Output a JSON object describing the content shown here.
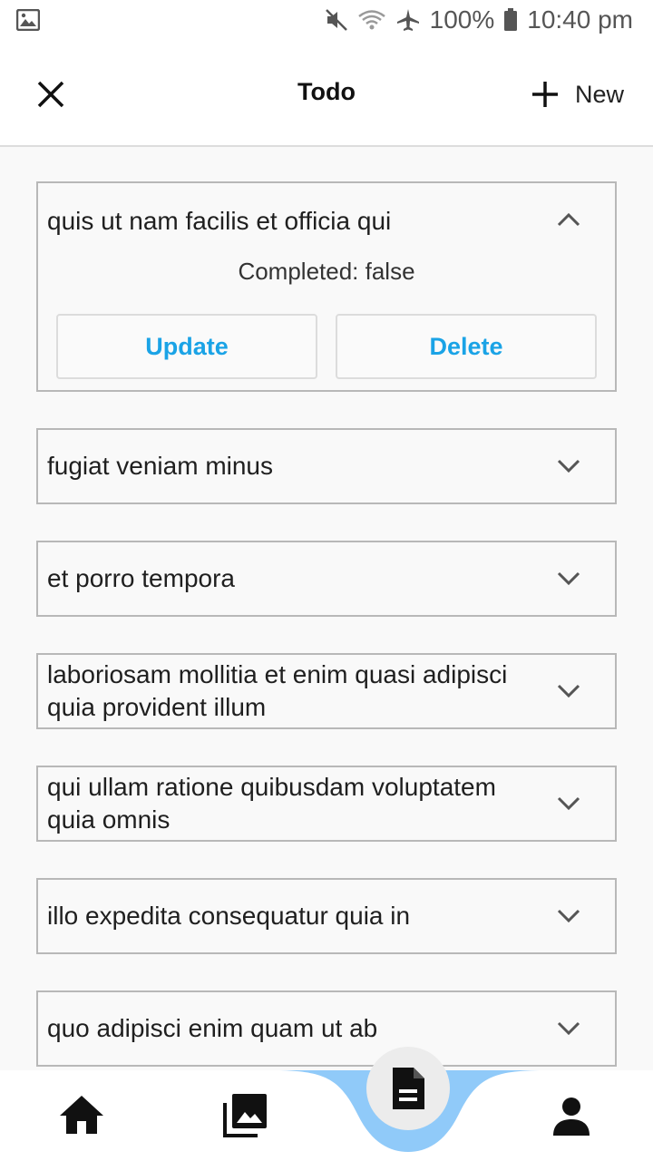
{
  "status_bar": {
    "battery": "100%",
    "time": "10:40 pm",
    "icons": [
      "image-icon",
      "mute-icon",
      "wifi-icon",
      "airplane-icon",
      "battery-icon"
    ]
  },
  "app_bar": {
    "title": "Todo",
    "new_label": "New",
    "icons": [
      "close-icon",
      "plus-icon"
    ]
  },
  "todos": [
    {
      "title": "quis ut nam facilis et officia qui",
      "expanded": true,
      "completed_text": "Completed: false",
      "update_label": "Update",
      "delete_label": "Delete"
    },
    {
      "title": "fugiat veniam minus",
      "expanded": false
    },
    {
      "title": "et porro tempora",
      "expanded": false
    },
    {
      "title": "laboriosam mollitia et enim quasi adipisci quia provident illum",
      "expanded": false
    },
    {
      "title": "qui ullam ratione quibusdam voluptatem quia omnis",
      "expanded": false
    },
    {
      "title": "illo expedita consequatur quia in",
      "expanded": false
    },
    {
      "title": "quo adipisci enim quam ut ab",
      "expanded": false
    }
  ],
  "bottom_nav": {
    "items": [
      "home-icon",
      "gallery-icon",
      "document-icon",
      "person-icon"
    ],
    "active": "document-icon",
    "accent": "#90caf9"
  },
  "colors": {
    "button_text": "#1aa3e6",
    "card_border": "#b8b8b8",
    "background": "#f9f9f9"
  }
}
